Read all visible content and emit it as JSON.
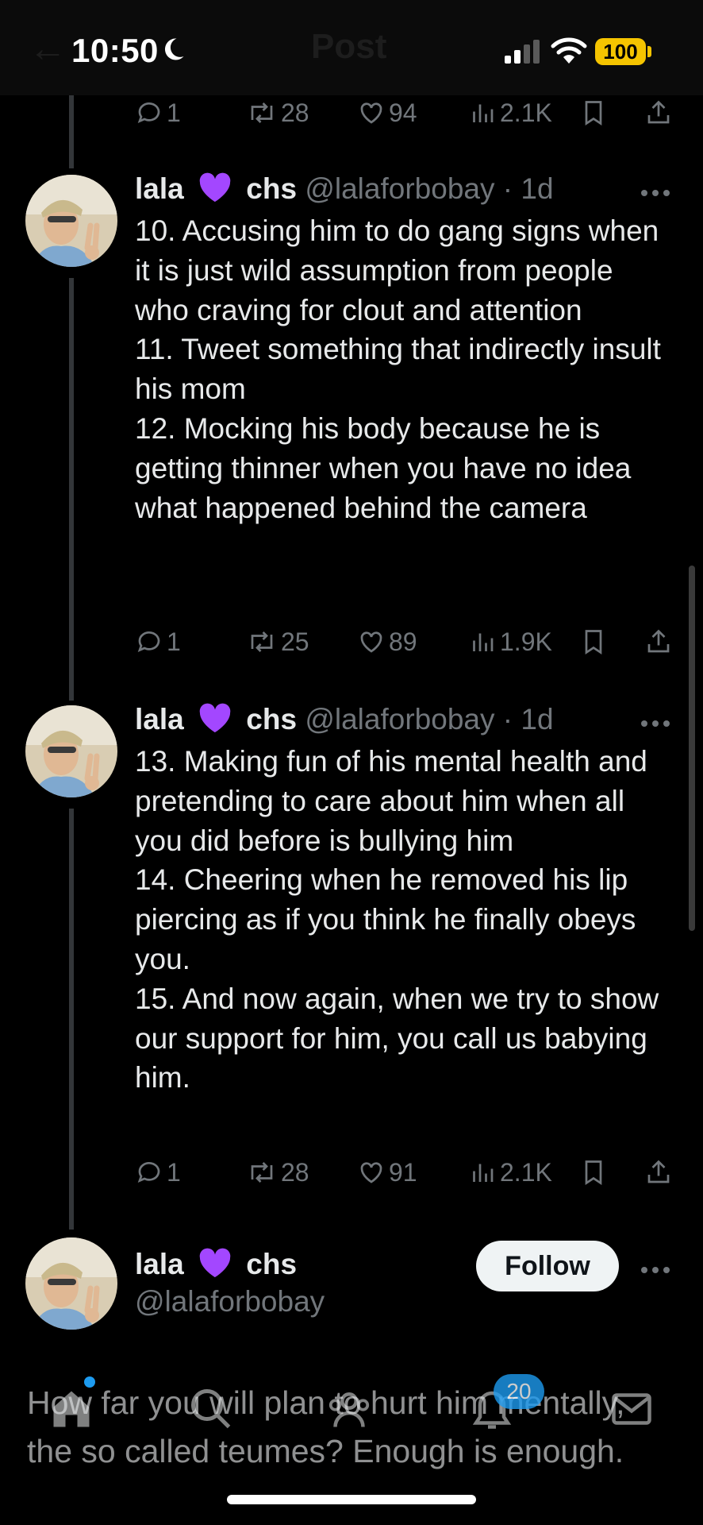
{
  "status_bar": {
    "time": "10:50",
    "battery": "100"
  },
  "header": {
    "title": "Post"
  },
  "tweets": [
    {
      "name": "lala",
      "name2": "chs",
      "handle": "@lalaforbobay",
      "time": "· 1d",
      "text": "10. Accusing him to do gang signs when it is just wild assumption from people who craving for clout and attention\n11. Tweet something that indirectly insult his mom\n12. Mocking his body because he is getting thinner when you have no idea what happened behind the camera",
      "replies": "1",
      "reposts": "25",
      "likes": "89",
      "views": "1.9K"
    },
    {
      "name": "lala",
      "name2": "chs",
      "handle": "@lalaforbobay",
      "time": "· 1d",
      "text": "13. Making fun of his mental health and pretending to care about him when all you did before is bullying him\n14. Cheering when he removed his lip piercing as if you think he finally obeys you.\n15. And now again, when we try to show our support for him, you call us babying him.",
      "replies": "1",
      "reposts": "28",
      "likes": "91",
      "views": "2.1K"
    }
  ],
  "top_actions": {
    "replies": "1",
    "reposts": "28",
    "likes": "94",
    "views": "2.1K"
  },
  "main_post": {
    "name": "lala",
    "name2": "chs",
    "handle": "@lalaforbobay",
    "follow_label": "Follow",
    "text": "How far you will plan to hurt him mentally, the so called teumes? Enough is enough."
  },
  "tabbar": {
    "notifications_badge": "20"
  },
  "colors": {
    "heart": "#a347ff",
    "accent": "#1d9bf0",
    "muted": "#71767b"
  }
}
